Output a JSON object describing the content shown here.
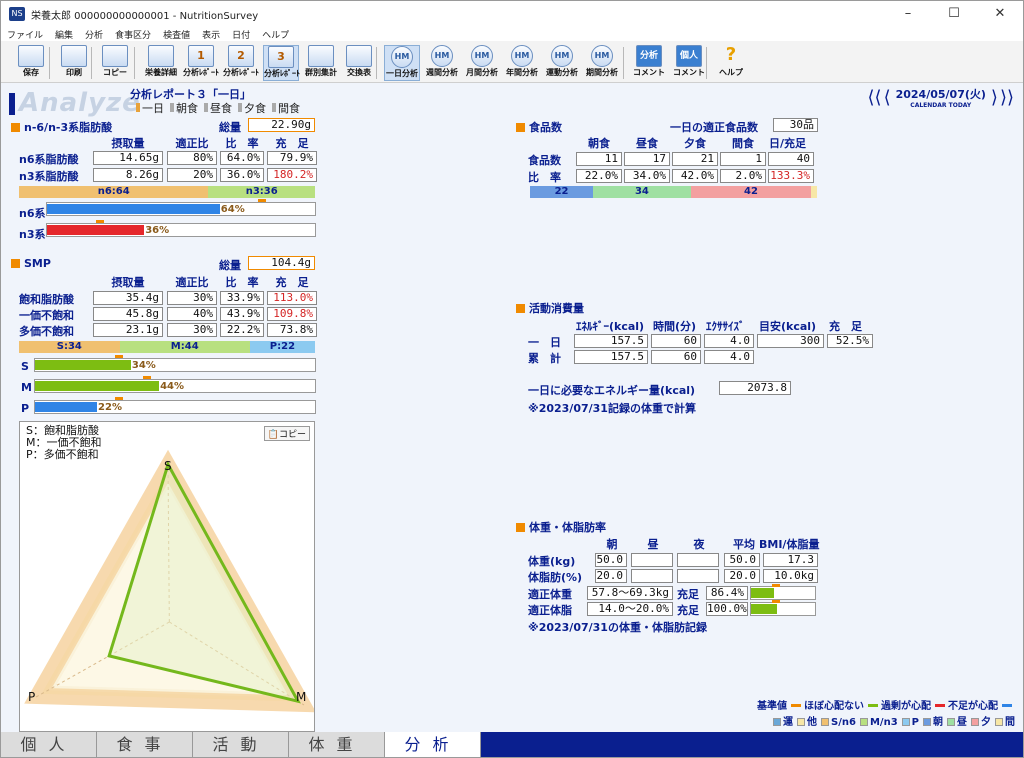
{
  "window": {
    "title": "栄養太郎 000000000000001 - NutritionSurvey",
    "app_icon": "NS"
  },
  "menu": [
    "ファイル",
    "編集",
    "分析",
    "食事区分",
    "検査値",
    "表示",
    "日付",
    "ヘルプ"
  ],
  "toolbar": [
    {
      "label": "保存",
      "icon": "save-icon"
    },
    {
      "label": "印刷",
      "icon": "print-icon"
    },
    {
      "label": "コピー",
      "icon": "copy-icon"
    },
    {
      "label": "栄養詳細",
      "icon": "nutrition-detail-icon"
    },
    {
      "label": "分析ﾚﾎﾟｰﾄ",
      "num": "1",
      "icon": "report1-icon"
    },
    {
      "label": "分析ﾚﾎﾟｰﾄ",
      "num": "2",
      "icon": "report2-icon"
    },
    {
      "label": "分析ﾚﾎﾟｰﾄ",
      "num": "3",
      "icon": "report3-icon",
      "selected": true
    },
    {
      "label": "群別集計",
      "icon": "group-icon"
    },
    {
      "label": "交換表",
      "icon": "exchange-icon"
    },
    {
      "label": "一日分析",
      "icon": "day-analysis-icon",
      "selected": true
    },
    {
      "label": "週間分析",
      "icon": "week-analysis-icon"
    },
    {
      "label": "月間分析",
      "icon": "month-analysis-icon"
    },
    {
      "label": "年間分析",
      "icon": "year-analysis-icon"
    },
    {
      "label": "運動分析",
      "icon": "exercise-analysis-icon"
    },
    {
      "label": "期間分析",
      "icon": "period-analysis-icon"
    },
    {
      "label": "コメント",
      "icon": "comment-icon",
      "top": "分析"
    },
    {
      "label": "コメント",
      "icon": "personal-comment-icon",
      "top": "個人"
    },
    {
      "label": "ヘルプ",
      "icon": "help-icon"
    }
  ],
  "header": {
    "logo": "Analyze",
    "report_title": "分析レポート３「一日」",
    "meal_opts": [
      "一日",
      "朝食",
      "昼食",
      "夕食",
      "間食"
    ],
    "date": "2024/05/07(火)",
    "calendar": "CALENDAR",
    "today": "TODAY"
  },
  "n6n3": {
    "title": "n-6/n-3系脂肪酸",
    "total_label": "総量",
    "total": "22.90g",
    "cols": [
      "摂取量",
      "適正比",
      "比　率",
      "充　足"
    ],
    "rows": [
      {
        "label": "n6系脂肪酸",
        "vals": [
          "14.65g",
          "80%",
          "64.0%",
          "79.9%"
        ]
      },
      {
        "label": "n3系脂肪酸",
        "vals": [
          "8.26g",
          "20%",
          "36.0%",
          "180.2%"
        ]
      }
    ],
    "ratio": [
      "n6:64",
      "n3:36"
    ],
    "bars": [
      {
        "label": "n6系",
        "pct": 64,
        "text": "64%",
        "color": "#2f84e6"
      },
      {
        "label": "n3系",
        "pct": 36,
        "text": "36%",
        "color": "#e5272b"
      }
    ]
  },
  "smp": {
    "title": "SMP",
    "total_label": "総量",
    "total": "104.4g",
    "cols": [
      "摂取量",
      "適正比",
      "比　率",
      "充　足"
    ],
    "rows": [
      {
        "label": "飽和脂肪酸",
        "vals": [
          "35.4g",
          "30%",
          "33.9%",
          "113.0%"
        ]
      },
      {
        "label": "一価不飽和",
        "vals": [
          "45.8g",
          "40%",
          "43.9%",
          "109.8%"
        ]
      },
      {
        "label": "多価不飽和",
        "vals": [
          "23.1g",
          "30%",
          "22.2%",
          "73.8%"
        ]
      }
    ],
    "ratio": [
      "S:34",
      "M:44",
      "P:22"
    ],
    "bars": [
      {
        "label": "S",
        "pct": 34,
        "text": "34%",
        "color": "#7dbd12"
      },
      {
        "label": "M",
        "pct": 44,
        "text": "44%",
        "color": "#7dbd12"
      },
      {
        "label": "P",
        "pct": 22,
        "text": "22%",
        "color": "#2f84e6"
      }
    ]
  },
  "radar": {
    "legend": [
      "S：飽和脂肪酸",
      "M：一価不飽和",
      "P：多価不飽和"
    ],
    "copy": "コピー",
    "axes": [
      "S",
      "M",
      "P"
    ],
    "values": {
      "S": 0.95,
      "M": 0.91,
      "P": 0.43
    }
  },
  "food": {
    "title": "食品数",
    "ideal_label": "一日の適正食品数",
    "ideal": "30品",
    "cols": [
      "朝食",
      "昼食",
      "夕食",
      "間食",
      "日/充足"
    ],
    "rows": [
      {
        "label": "食品数",
        "vals": [
          "11",
          "17",
          "21",
          "1",
          "40"
        ]
      },
      {
        "label": "比　率",
        "vals": [
          "22.0%",
          "34.0%",
          "42.0%",
          "2.0%",
          "133.3%"
        ]
      }
    ],
    "bar": [
      {
        "text": "22",
        "pct": 22,
        "color": "#6b9be0"
      },
      {
        "text": "34",
        "pct": 34,
        "color": "#9fe0a2"
      },
      {
        "text": "42",
        "pct": 42,
        "color": "#f3a0a0"
      },
      {
        "text": "",
        "pct": 2,
        "color": "#f7e7a6"
      }
    ]
  },
  "activity": {
    "title": "活動消費量",
    "cols": [
      "ｴﾈﾙｷﾞｰ(kcal)",
      "時間(分)",
      "ｴｸｻｻｲｽﾞ",
      "目安(kcal)",
      "充　足"
    ],
    "rows": [
      {
        "label": "一　日",
        "vals": [
          "157.5",
          "60",
          "4.0",
          "300",
          "52.5%"
        ]
      },
      {
        "label": "累　計",
        "vals": [
          "157.5",
          "60",
          "4.0"
        ]
      }
    ],
    "need_label": "一日に必要なエネルギー量(kcal)",
    "need": "2073.8",
    "note": "※2023/07/31記録の体重で計算"
  },
  "body": {
    "title": "体重・体脂肪率",
    "cols": [
      "朝",
      "昼",
      "夜",
      "平均",
      "BMI/体脂量"
    ],
    "rows": [
      {
        "label": "体重(kg)",
        "vals": [
          "50.0",
          "",
          "",
          "50.0",
          "17.3"
        ]
      },
      {
        "label": "体脂肪(%)",
        "vals": [
          "20.0",
          "",
          "",
          "20.0",
          "10.0kg"
        ]
      }
    ],
    "ideal_w_label": "適正体重",
    "ideal_w": "57.8〜69.3kg",
    "fill_label": "充足",
    "fill_w": "86.4%",
    "fill_w_pct": 86.4,
    "ideal_f_label": "適正体脂",
    "ideal_f": "14.0〜20.0%",
    "fill_f": "100.0%",
    "fill_f_pct": 100,
    "note": "※2023/07/31の体重・体脂肪記録"
  },
  "legend": {
    "line1": [
      {
        "t": "基準値",
        "c": "#f08a00",
        "type": "line"
      },
      {
        "t": "ほぼ心配ない",
        "c": "#7dbd12",
        "type": "line"
      },
      {
        "t": "過剰が心配",
        "c": "#e5272b",
        "type": "line"
      },
      {
        "t": "不足が心配",
        "c": "#2f84e6",
        "type": "line"
      }
    ],
    "line2": [
      {
        "t": "運",
        "c": "#6aa8d8"
      },
      {
        "t": "他",
        "c": "#f7e7a6"
      },
      {
        "t": "S/n6",
        "c": "#f0c070"
      },
      {
        "t": "M/n3",
        "c": "#b8e080"
      },
      {
        "t": "P",
        "c": "#8ccaf0"
      },
      {
        "t": "朝",
        "c": "#6b9be0"
      },
      {
        "t": "昼",
        "c": "#9fe0a2"
      },
      {
        "t": "夕",
        "c": "#f3a0a0"
      },
      {
        "t": "間",
        "c": "#f7e7a6"
      }
    ]
  },
  "tabs": [
    "個人",
    "食事",
    "活動",
    "体重",
    "分析"
  ]
}
